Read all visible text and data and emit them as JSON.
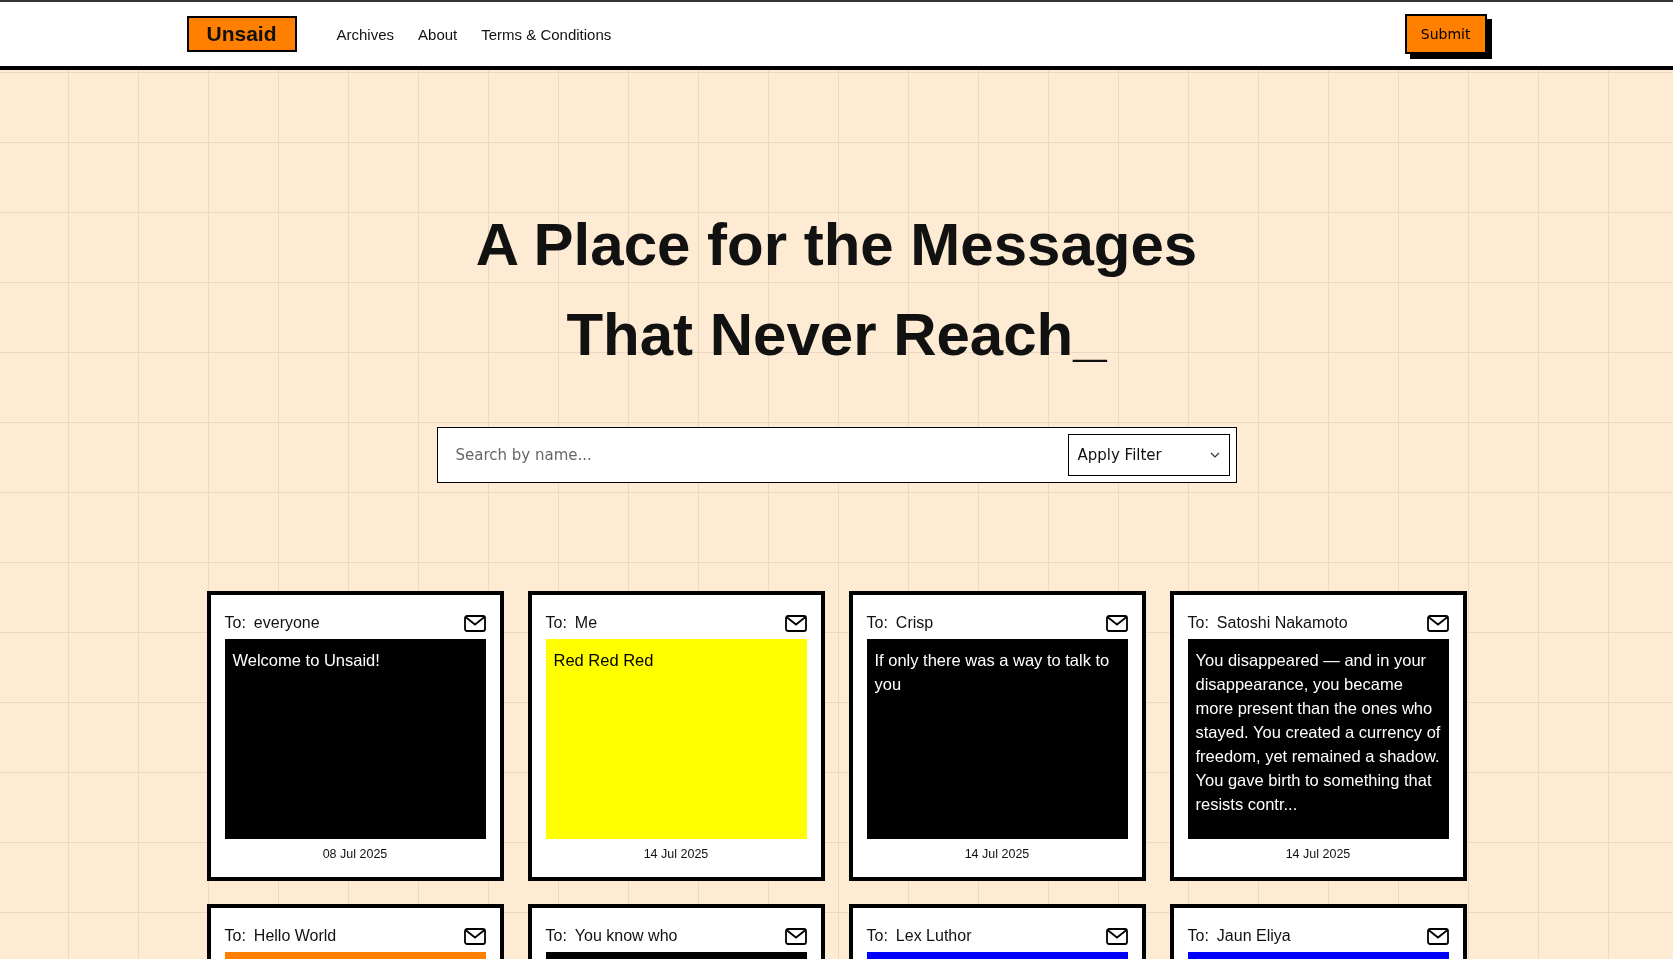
{
  "header": {
    "logo": "Unsaid",
    "nav": [
      {
        "label": "Archives"
      },
      {
        "label": "About"
      },
      {
        "label": "Terms & Conditions"
      }
    ],
    "submit": "Submit"
  },
  "hero": {
    "lines": [
      "A Place for the Messages",
      "That Never Reach_"
    ]
  },
  "search": {
    "placeholder": "Search by name...",
    "filter": "Apply Filter"
  },
  "cards": [
    {
      "to_label": "To:",
      "recipient": "everyone",
      "color": "#000000",
      "message": "Welcome to Unsaid!",
      "date": "08 Jul 2025"
    },
    {
      "to_label": "To:",
      "recipient": "Me",
      "color": "#ffff00",
      "message": "Red Red Red",
      "date": "14 Jul 2025"
    },
    {
      "to_label": "To:",
      "recipient": "Crisp",
      "color": "#000000",
      "message": "If only there was a way to talk to you",
      "date": "14 Jul 2025"
    },
    {
      "to_label": "To:",
      "recipient": "Satoshi Nakamoto",
      "color": "#000000",
      "message": "You disappeared — and in your disappearance, you became more present than the ones who stayed. You created a currency of freedom, yet remained a shadow. You gave birth to something that resists contr...",
      "date": "14 Jul 2025"
    },
    {
      "to_label": "To:",
      "recipient": "Hello World",
      "color": "#ff7f00"
    },
    {
      "to_label": "To:",
      "recipient": "You know who",
      "color": "#000000"
    },
    {
      "to_label": "To:",
      "recipient": "Lex Luthor",
      "color": "#0000ff"
    },
    {
      "to_label": "To:",
      "recipient": "Jaun Eliya",
      "color": "#0000ff"
    }
  ]
}
